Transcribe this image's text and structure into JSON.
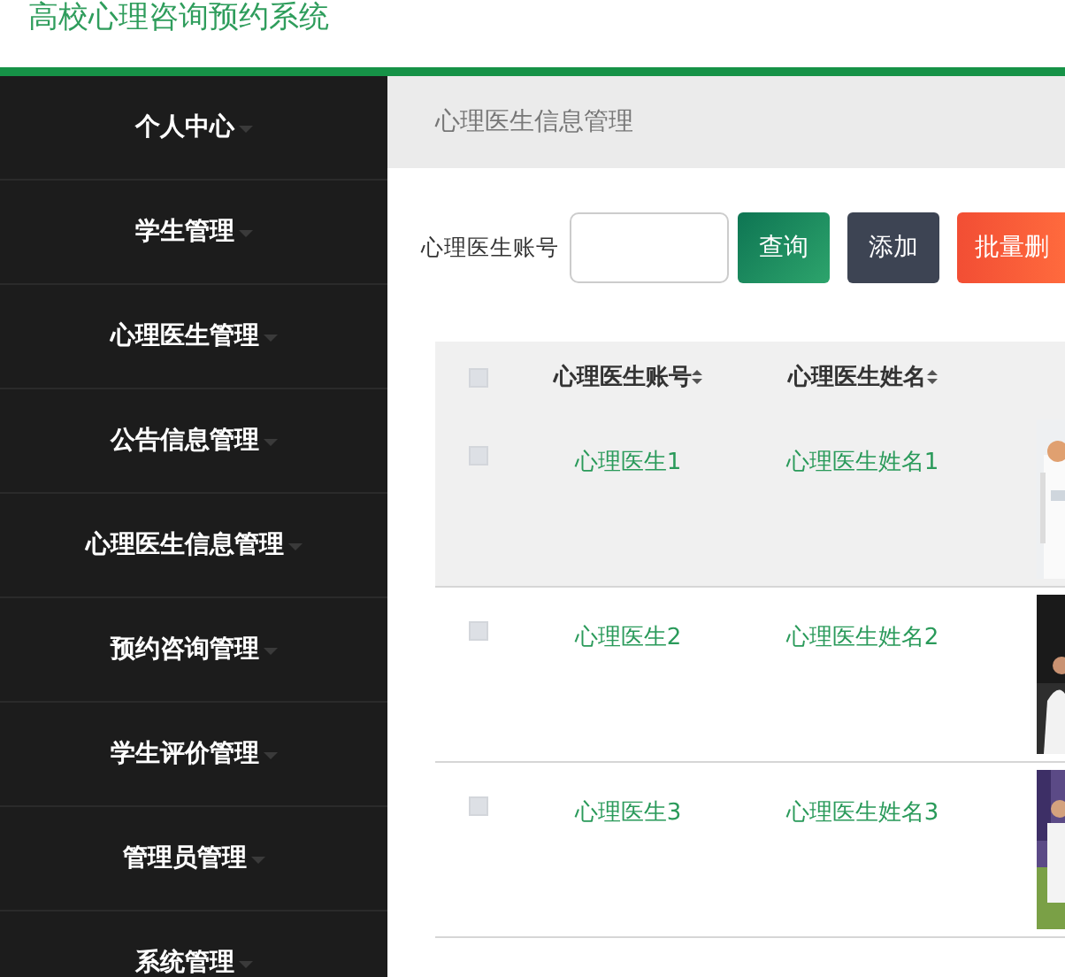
{
  "header": {
    "title": "高校心理咨询预约系统"
  },
  "sidebar": {
    "items": [
      {
        "label": "个人中心"
      },
      {
        "label": "学生管理"
      },
      {
        "label": "心理医生管理"
      },
      {
        "label": "公告信息管理"
      },
      {
        "label": "心理医生信息管理"
      },
      {
        "label": "预约咨询管理"
      },
      {
        "label": "学生评价管理"
      },
      {
        "label": "管理员管理"
      },
      {
        "label": "系统管理"
      }
    ]
  },
  "breadcrumb": {
    "title": "心理医生信息管理"
  },
  "search": {
    "label": "心理医生账号",
    "buttons": [
      {
        "label": "查询",
        "kind": "search"
      },
      {
        "label": "添加",
        "kind": "add"
      },
      {
        "label": "批量删",
        "kind": "delete"
      }
    ]
  },
  "table": {
    "header_checked": false,
    "columns": [
      {
        "label": "心理医生账号",
        "sortable": true
      },
      {
        "label": "心理医生姓名",
        "sortable": true
      }
    ],
    "rows": [
      {
        "account": "心理医生1",
        "name": "心理医生姓名1",
        "checked": false,
        "highlighted": true
      },
      {
        "account": "心理医生2",
        "name": "心理医生姓名2",
        "checked": false,
        "highlighted": false
      },
      {
        "account": "心理医生3",
        "name": "心理医生姓名3",
        "checked": false,
        "highlighted": false
      }
    ]
  }
}
